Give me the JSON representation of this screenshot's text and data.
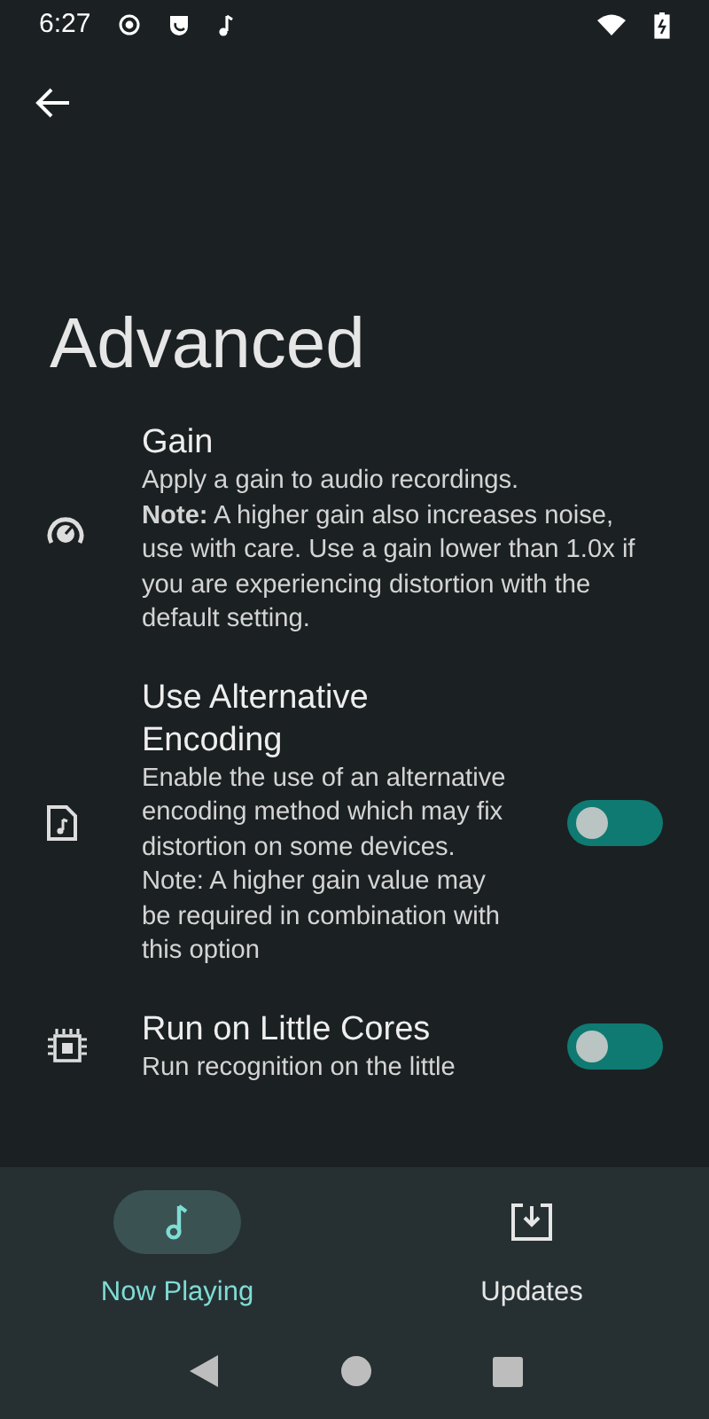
{
  "status_bar": {
    "time": "6:27"
  },
  "title": "Advanced",
  "settings": [
    {
      "kind": "text",
      "title": "Gain",
      "description": "Apply a gain to audio recordings.\n**Note:** A higher gain also increases noise, use with care. Use a gain lower than 1.0x if you are experiencing distortion with the default setting."
    },
    {
      "kind": "switch",
      "title": "Use Alternative Encoding",
      "description": "Enable the use of an alternative encoding method which may fix distortion on some devices.\nNote: A higher gain value may be required in combination with this option",
      "on": false
    },
    {
      "kind": "switch",
      "title": "Run on Little Cores",
      "description": "Run recognition on the little",
      "on": false
    }
  ],
  "bottom_nav": [
    {
      "label": "Now Playing",
      "selected": true
    },
    {
      "label": "Updates",
      "selected": false
    }
  ]
}
